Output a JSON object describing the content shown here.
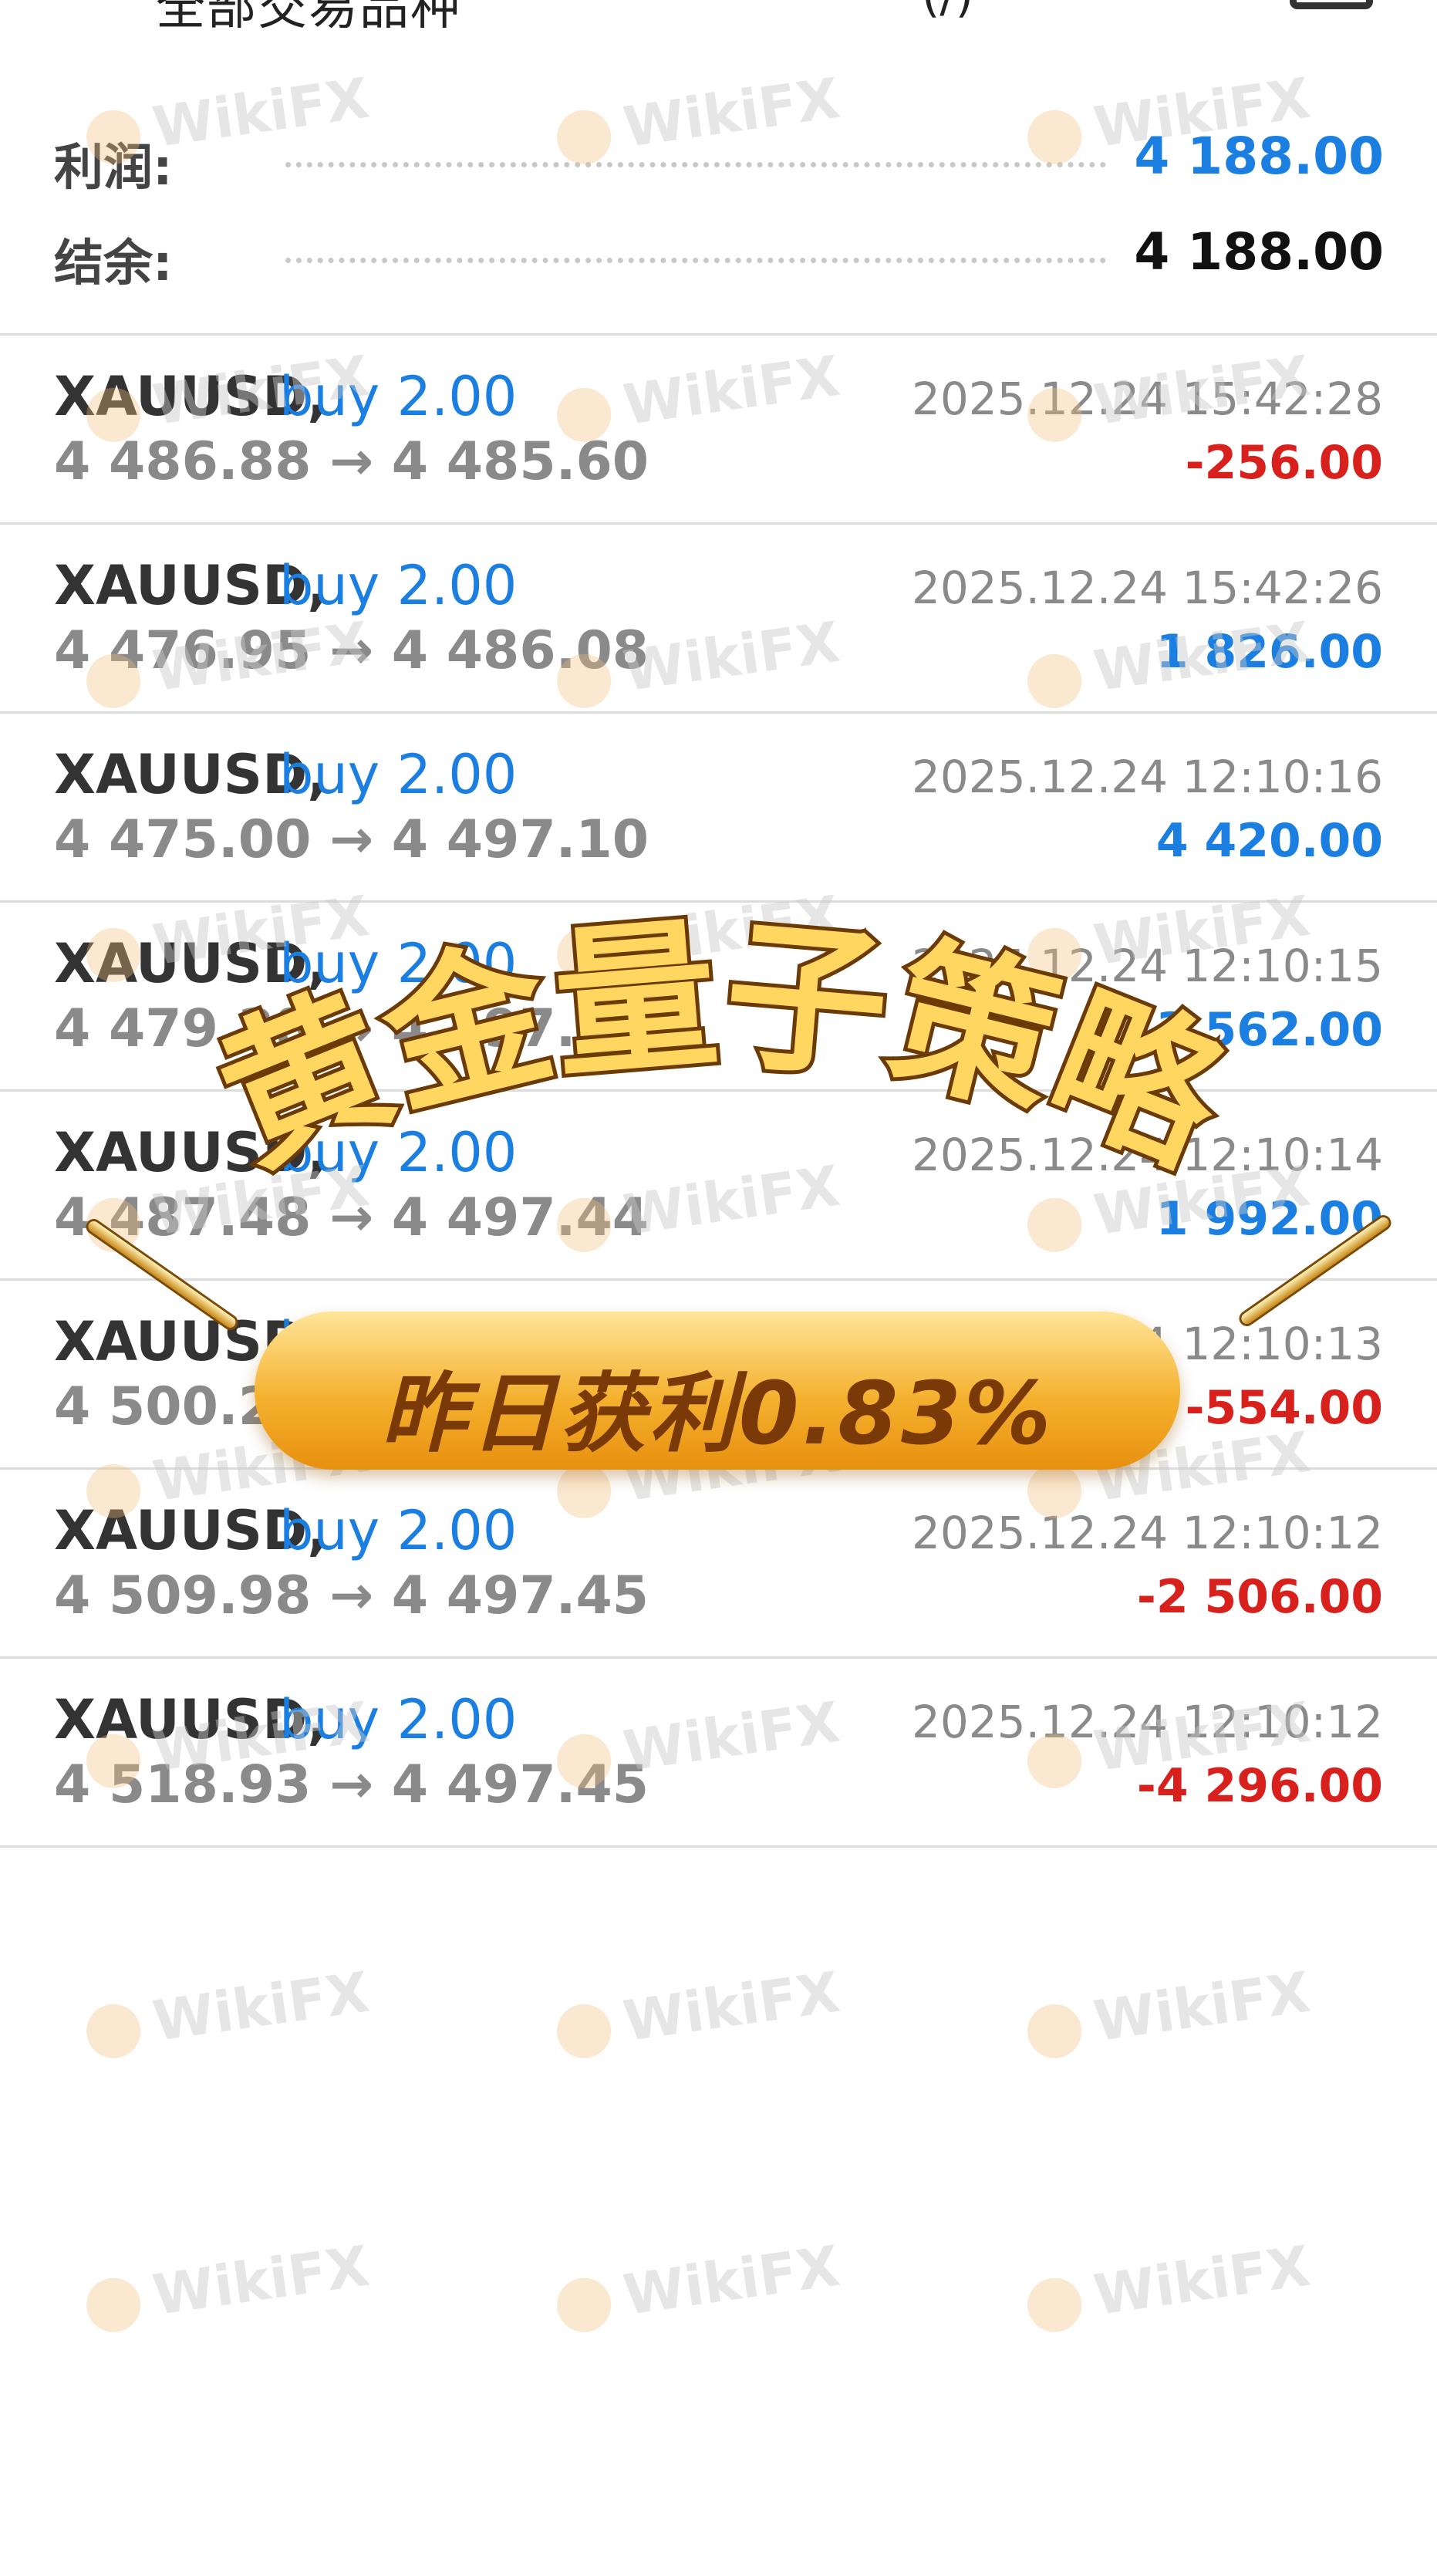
{
  "header": {
    "title": "全部交易品种",
    "extra": "(/)"
  },
  "summary": [
    {
      "label": "利润:",
      "value": "4 188.00",
      "color": "#1a7fe0"
    },
    {
      "label": "结余:",
      "value": "4 188.00",
      "color": "#111111"
    }
  ],
  "trades": [
    {
      "symbol": "XAUUSD,",
      "direction": "buy 2.00",
      "time": "2025.12.24 15:42:28",
      "prices": "4 486.88 → 4 485.60",
      "profit": "-256.00",
      "profit_color": "#d8201c"
    },
    {
      "symbol": "XAUUSD,",
      "direction": "buy 2.00",
      "time": "2025.12.24 15:42:26",
      "prices": "4 476.95 → 4 486.08",
      "profit": "1 826.00",
      "profit_color": "#1a7fe0"
    },
    {
      "symbol": "XAUUSD,",
      "direction": "buy 2.00",
      "time": "2025.12.24 12:10:16",
      "prices": "4 475.00 → 4 497.10",
      "profit": "4 420.00",
      "profit_color": "#1a7fe0"
    },
    {
      "symbol": "XAUUSD,",
      "direction": "buy 2.00",
      "time": "2025.12.24 12:10:15",
      "prices": "4 479.28 → 4 497.09",
      "profit": "3 562.00",
      "profit_color": "#1a7fe0"
    },
    {
      "symbol": "XAUUSD,",
      "direction": "buy 2.00",
      "time": "2025.12.24 12:10:14",
      "prices": "4 487.48 → 4 497.44",
      "profit": "1 992.00",
      "profit_color": "#1a7fe0"
    },
    {
      "symbol": "XAUUSD,",
      "direction": "buy 2.00",
      "time": "2025.12.24 12:10:13",
      "prices": "4 500.22 → 4 497.45",
      "profit": "-554.00",
      "profit_color": "#d8201c"
    },
    {
      "symbol": "XAUUSD,",
      "direction": "buy 2.00",
      "time": "2025.12.24 12:10:12",
      "prices": "4 509.98 → 4 497.45",
      "profit": "-2 506.00",
      "profit_color": "#d8201c"
    },
    {
      "symbol": "XAUUSD,",
      "direction": "buy 2.00",
      "time": "2025.12.24 12:10:12",
      "prices": "4 518.93 → 4 497.45",
      "profit": "-4 296.00",
      "profit_color": "#d8201c"
    }
  ],
  "overlay": {
    "title": "黄金量子策略",
    "subtitle": "昨日获利0.83%"
  },
  "watermark": "WikiFX"
}
